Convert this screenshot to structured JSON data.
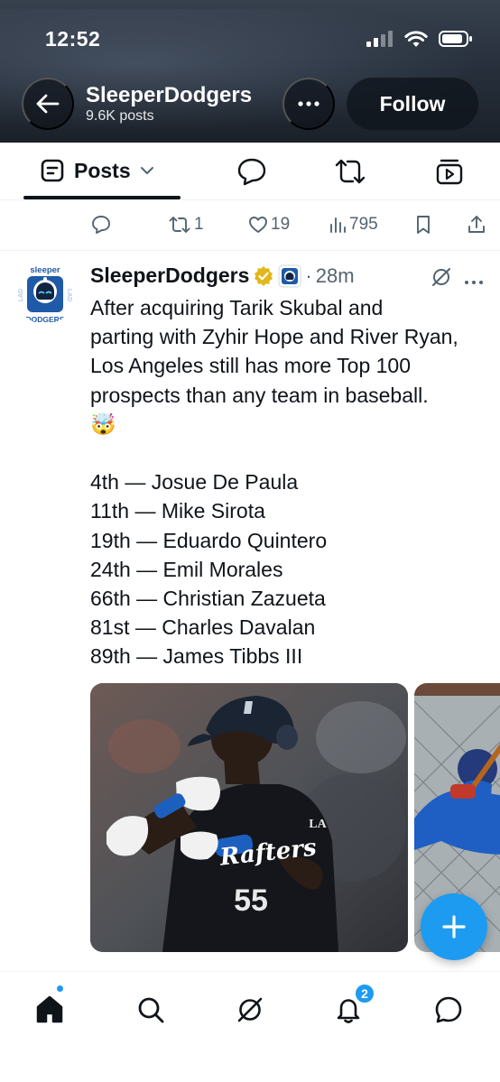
{
  "status_bar": {
    "time": "12:52"
  },
  "header": {
    "title": "SleeperDodgers",
    "post_count": "9.6K posts",
    "follow_label": "Follow"
  },
  "tabs": {
    "active_label": "Posts"
  },
  "prev_tweet_actions": {
    "replies": "",
    "reposts": "1",
    "likes": "19",
    "views": "795"
  },
  "tweet": {
    "display_name": "SleeperDodgers",
    "time": "28m",
    "separator": "·",
    "avatar_text_top": "sleeper",
    "avatar_text_bottom": "DODGERS",
    "avatar_side_text": "LAD",
    "lines": [
      "After acquiring Tarik Skubal and",
      "parting with Zyhir Hope and River Ryan,",
      "Los Angeles still has more Top 100",
      "prospects than any team in baseball.",
      "🤯",
      "",
      "4th — Josue De Paula",
      "11th — Mike Sirota",
      "19th — Eduardo Quintero",
      "24th — Emil Morales",
      "66th — Christian Zazueta",
      "81st — Charles Davalan",
      "89th — James Tibbs III"
    ],
    "jersey_number": "55",
    "jersey_text": "Rafters",
    "helmet_logo": "LA"
  },
  "bottom_nav": {
    "notifications_badge": "2"
  },
  "colors": {
    "accent": "#1d9bf0",
    "verified": "#e2b719",
    "text": "#0f1419",
    "muted": "#536471"
  }
}
